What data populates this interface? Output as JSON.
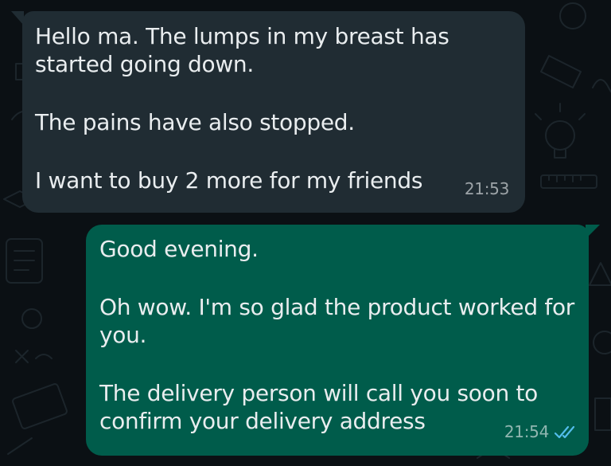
{
  "conversation": {
    "messages": [
      {
        "direction": "incoming",
        "paragraphs": [
          [
            "Hello ma. The lumps in my breast has",
            "started going down."
          ],
          [
            "The pains have also stopped."
          ],
          [
            "I want to buy 2 more for my friends"
          ]
        ],
        "time": "21:53"
      },
      {
        "direction": "outgoing",
        "paragraphs": [
          [
            "Good evening."
          ],
          [
            "Oh wow. I'm so glad the product worked for",
            "you."
          ],
          [
            "The delivery person will call you soon to",
            "confirm your delivery address"
          ]
        ],
        "time": "21:54",
        "status_icon": "double-check-read-icon"
      }
    ]
  },
  "theme": {
    "background": "#0b1014",
    "incoming_bubble": "#202c33",
    "outgoing_bubble": "#005c4b",
    "text": "#e9edef",
    "read_tick": "#53bdeb"
  }
}
